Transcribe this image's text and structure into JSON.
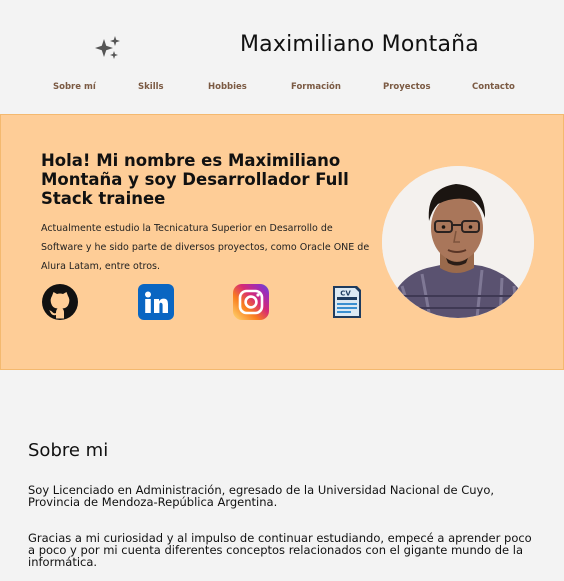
{
  "header": {
    "logo_icon": "sparkles-icon",
    "site_name": "Maximiliano Montaña"
  },
  "nav": {
    "items": [
      {
        "label": "Sobre mí"
      },
      {
        "label": "Skills"
      },
      {
        "label": "Hobbies"
      },
      {
        "label": "Formación"
      },
      {
        "label": "Proyectos"
      },
      {
        "label": "Contacto"
      }
    ]
  },
  "hero": {
    "title": "Hola! Mi nombre es Maximiliano Montaña y soy Desarrollador Full Stack trainee",
    "description": "Actualmente estudio la Tecnicatura Superior en Desarrollo de Software y he sido parte de diversos proyectos, como Oracle ONE de Alura Latam, entre otros.",
    "social_links": [
      {
        "icon": "github-icon"
      },
      {
        "icon": "linkedin-icon"
      },
      {
        "icon": "instagram-icon"
      },
      {
        "icon": "cv-document-icon",
        "text": "CV"
      }
    ],
    "background_color": "#fecd97"
  },
  "about": {
    "title": "Sobre mi",
    "paragraphs": [
      "Soy Licenciado en Administración, egresado de la Universidad Nacional de Cuyo, Provincia de Mendoza-República Argentina.",
      "Gracias a mi curiosidad y al impulso de continuar estudiando, empecé a aprender poco a poco y por mi cuenta diferentes conceptos relacionados con el gigante mundo de la informática."
    ]
  }
}
